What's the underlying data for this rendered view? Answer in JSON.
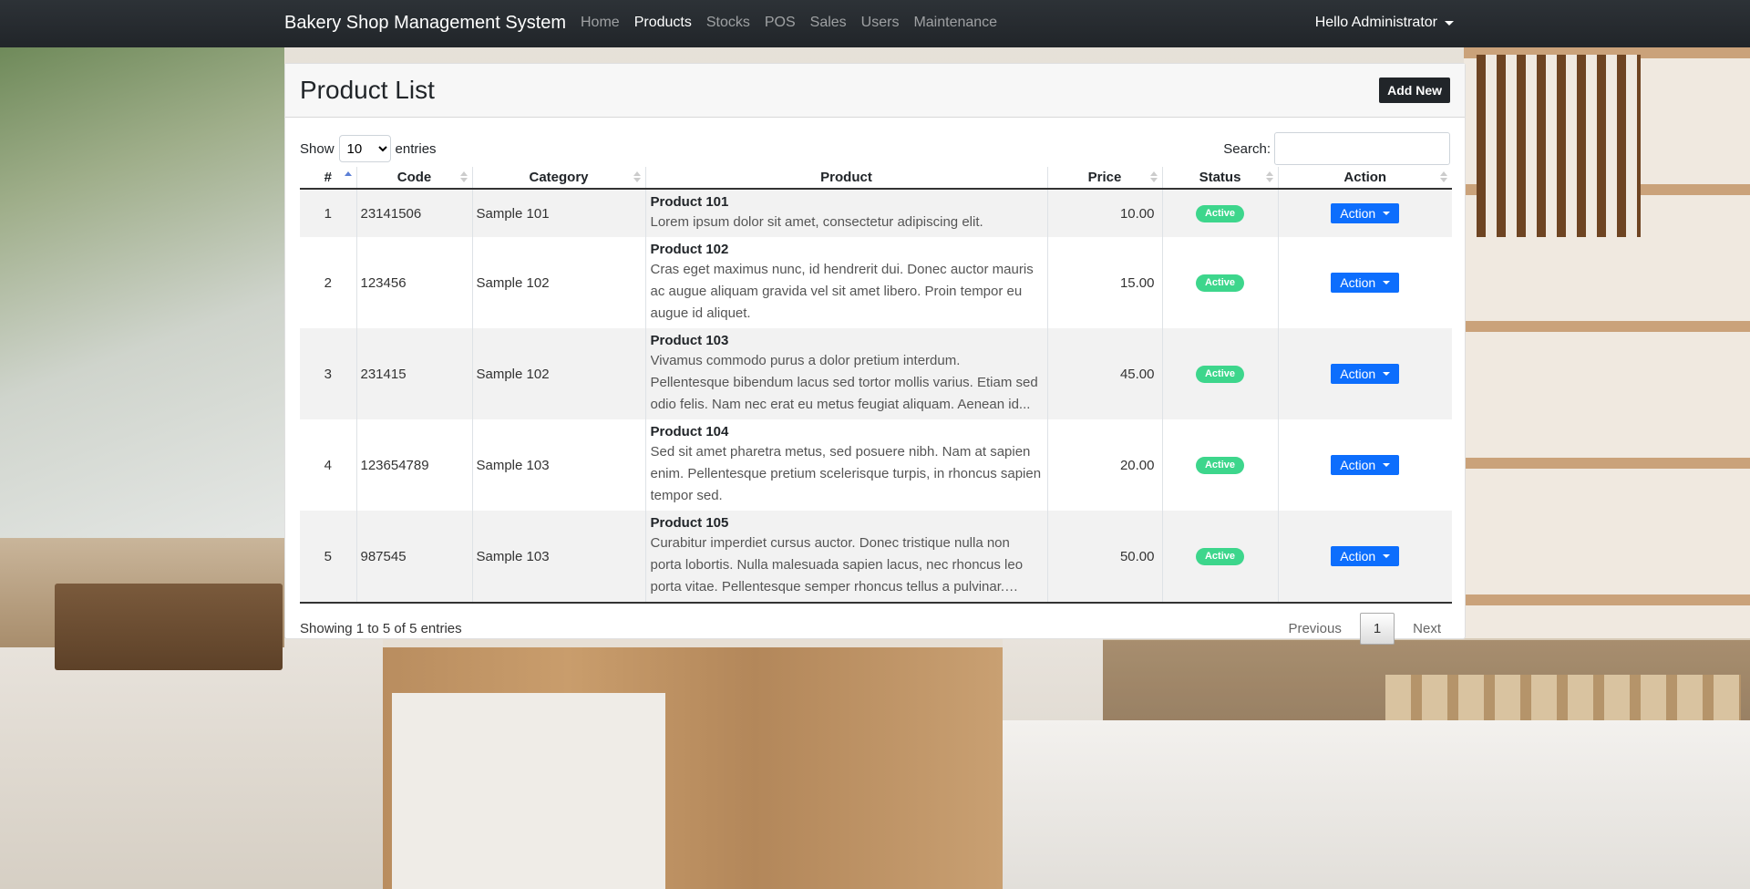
{
  "navbar": {
    "brand": "Bakery Shop Management System",
    "links": [
      {
        "label": "Home",
        "active": false
      },
      {
        "label": "Products",
        "active": true
      },
      {
        "label": "Stocks",
        "active": false
      },
      {
        "label": "POS",
        "active": false
      },
      {
        "label": "Sales",
        "active": false
      },
      {
        "label": "Users",
        "active": false
      },
      {
        "label": "Maintenance",
        "active": false
      }
    ],
    "user_greeting": "Hello Administrator"
  },
  "card": {
    "title": "Product List",
    "add_button": "Add New"
  },
  "table_controls": {
    "show_label": "Show",
    "entries_value": "10",
    "entries_label": "entries",
    "search_label": "Search:",
    "search_value": ""
  },
  "table": {
    "columns": [
      "#",
      "Code",
      "Category",
      "Product",
      "Price",
      "Status",
      "Action"
    ],
    "rows": [
      {
        "num": "1",
        "code": "23141506",
        "category": "Sample 101",
        "name": "Product 101",
        "description": "Lorem ipsum dolor sit amet, consectetur adipiscing elit.",
        "price": "10.00",
        "status": "Active",
        "action": "Action"
      },
      {
        "num": "2",
        "code": "123456",
        "category": "Sample 102",
        "name": "Product 102",
        "description": "Cras eget maximus nunc, id hendrerit dui. Donec auctor mauris ac augue aliquam gravida vel sit amet libero. Proin tempor eu augue id aliquet.",
        "price": "15.00",
        "status": "Active",
        "action": "Action"
      },
      {
        "num": "3",
        "code": "231415",
        "category": "Sample 102",
        "name": "Product 103",
        "description": "Vivamus commodo purus a dolor pretium interdum. Pellentesque bibendum lacus sed tortor mollis varius. Etiam sed odio felis. Nam nec erat eu metus feugiat aliquam. Aenean id...",
        "price": "45.00",
        "status": "Active",
        "action": "Action"
      },
      {
        "num": "4",
        "code": "123654789",
        "category": "Sample 103",
        "name": "Product 104",
        "description": "Sed sit amet pharetra metus, sed posuere nibh. Nam at sapien enim. Pellentesque pretium scelerisque turpis, in rhoncus sapien tempor sed.",
        "price": "20.00",
        "status": "Active",
        "action": "Action"
      },
      {
        "num": "5",
        "code": "987545",
        "category": "Sample 103",
        "name": "Product 105",
        "description": "Curabitur imperdiet cursus auctor. Donec tristique nulla non porta lobortis. Nulla malesuada sapien lacus, nec rhoncus leo porta vitae. Pellentesque semper rhoncus tellus a pulvinar. Mor...",
        "price": "50.00",
        "status": "Active",
        "action": "Action"
      }
    ]
  },
  "footer": {
    "info": "Showing 1 to 5 of 5 entries",
    "previous": "Previous",
    "current_page": "1",
    "next": "Next"
  },
  "colors": {
    "navbar": "#212529",
    "primary": "#0d6efd",
    "badge_active": "#3dd68c"
  }
}
